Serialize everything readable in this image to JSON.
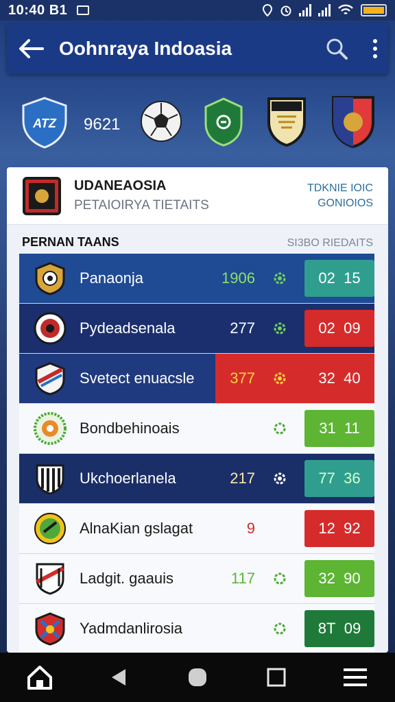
{
  "status": {
    "time": "10:40 B1"
  },
  "appbar": {
    "title": "Oohnraya Indoasia"
  },
  "crest_row": {
    "number": "9621"
  },
  "header_card": {
    "title": "UDANEAOSIA",
    "subtitle": "PETAIOIRYA TIETAITS",
    "right_line1": "TDKNIE IOIC",
    "right_line2": "GONIOIOS"
  },
  "section": {
    "title": "PERNAN TAANS",
    "link": "SI3BO RIEDAITS"
  },
  "rows": [
    {
      "name": "Panaonja",
      "value": "1906",
      "score_a": "02",
      "score_b": "15"
    },
    {
      "name": "Pydeadsenala",
      "value": "277",
      "score_a": "02",
      "score_b": "09"
    },
    {
      "name": "Svetect enuacsle",
      "value": "377",
      "score_a": "32",
      "score_b": "40"
    },
    {
      "name": "Bondbehinoais",
      "value": "",
      "score_a": "31",
      "score_b": "11"
    },
    {
      "name": "Ukchoerlanela",
      "value": "217",
      "score_a": "77",
      "score_b": "36"
    },
    {
      "name": "AlnaKian gslagat",
      "value": "9",
      "score_a": "12",
      "score_b": "92"
    },
    {
      "name": "Ladgit. gaauis",
      "value": "117",
      "score_a": "32",
      "score_b": "90"
    },
    {
      "name": "Yadmdanlirosia",
      "value": "",
      "score_a": "8T",
      "score_b": "09"
    }
  ],
  "colors": {
    "accent": "#1b3a86",
    "green_score": "#5db533",
    "red_score": "#d62b2b",
    "teal_score": "#2f9e8f",
    "dark_green_score": "#1f7a3a"
  },
  "icons": [
    "back-arrow-icon",
    "search-icon",
    "more-vert-icon",
    "home-icon",
    "nav-back-icon",
    "nav-home-icon",
    "nav-recents-icon",
    "menu-icon"
  ]
}
